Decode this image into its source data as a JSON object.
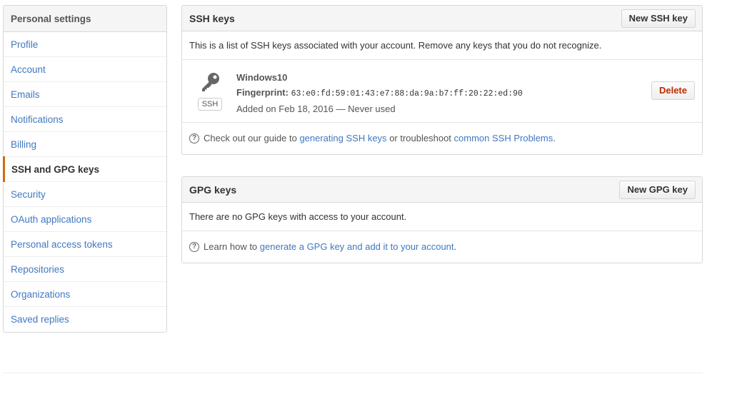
{
  "sidebar": {
    "header": "Personal settings",
    "items": [
      {
        "label": "Profile"
      },
      {
        "label": "Account"
      },
      {
        "label": "Emails"
      },
      {
        "label": "Notifications"
      },
      {
        "label": "Billing"
      },
      {
        "label": "SSH and GPG keys"
      },
      {
        "label": "Security"
      },
      {
        "label": "OAuth applications"
      },
      {
        "label": "Personal access tokens"
      },
      {
        "label": "Repositories"
      },
      {
        "label": "Organizations"
      },
      {
        "label": "Saved replies"
      }
    ],
    "selected": "SSH and GPG keys",
    "accent_color": "#d26911",
    "link_color": "#4078c0"
  },
  "ssh": {
    "title": "SSH keys",
    "new_button": "New SSH key",
    "intro": "This is a list of SSH keys associated with your account. Remove any keys that you do not recognize.",
    "key": {
      "icon": "key-icon",
      "type_label": "SSH",
      "name": "Windows10",
      "fingerprint_label": "Fingerprint:",
      "fingerprint": "63:e0:fd:59:01:43:e7:88:da:9a:b7:ff:20:22:ed:90",
      "added": "Added on Feb 18, 2016 — Never used",
      "delete_button": "Delete"
    },
    "help": {
      "icon": "question-icon",
      "prefix": "Check out our guide to",
      "link1": "generating SSH keys",
      "middle": "or troubleshoot",
      "link2": "common SSH Problems",
      "suffix": "."
    }
  },
  "gpg": {
    "title": "GPG keys",
    "new_button": "New GPG key",
    "empty": "There are no GPG keys with access to your account.",
    "help": {
      "icon": "question-icon",
      "prefix": "Learn how to",
      "link": "generate a GPG key and add it to your account",
      "suffix": "."
    }
  },
  "colors": {
    "delete": "#bd2c00",
    "header_bg": "#f5f5f5",
    "border": "#d8d8d8"
  }
}
